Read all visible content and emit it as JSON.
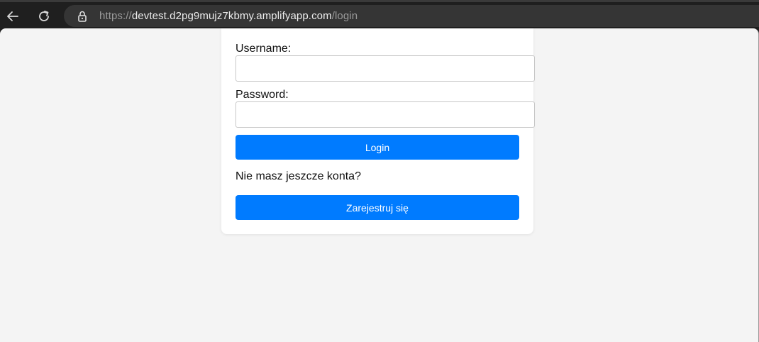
{
  "browser": {
    "url_scheme": "https://",
    "url_host": "devtest.d2pg9mujz7kbmy.amplifyapp.com",
    "url_path": "/login",
    "icons": {
      "back": "arrow-left-icon",
      "reload": "reload-icon",
      "lock": "lock-icon"
    }
  },
  "login_form": {
    "username_label": "Username:",
    "username_value": "",
    "password_label": "Password:",
    "password_value": "",
    "login_button": "Login",
    "register_prompt": "Nie masz jeszcze konta?",
    "register_button": "Zarejestruj się"
  },
  "colors": {
    "primary_button": "#007bff",
    "page_background": "#f4f4f4",
    "card_background": "#ffffff"
  }
}
